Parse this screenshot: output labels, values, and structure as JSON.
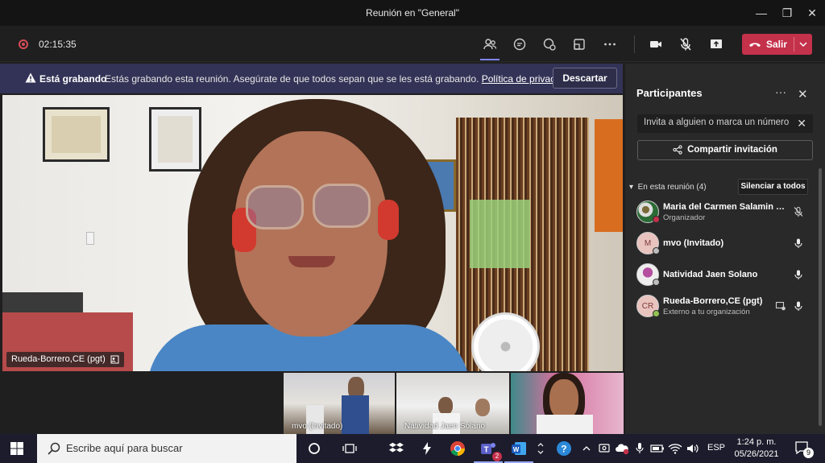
{
  "window": {
    "title": "Reunión en \"General\""
  },
  "toolbar": {
    "timer": "02:15:35",
    "leave_label": "Salir"
  },
  "banner": {
    "bold": "Está grabando",
    "message": "Estás grabando esta reunión. Asegúrate de que todos sepan que se les está grabando.",
    "privacy_link": "Política de privacidad",
    "dismiss": "Descartar"
  },
  "main_video": {
    "name": "Rueda-Borrero,CE (pgt)"
  },
  "thumbnails": [
    {
      "name": "mvo (Invitado)"
    },
    {
      "name": "Natividad Jaen Solano"
    },
    {
      "name": ""
    }
  ],
  "panel": {
    "title": "Participantes",
    "invite_placeholder": "Invita a alguien o marca un número",
    "share_label": "Compartir invitación",
    "in_meeting": "En esta reunión (4)",
    "mute_all": "Silenciar a todos",
    "participants": [
      {
        "name": "Maria del Carmen Salamin Ca...",
        "role": "Organizador",
        "initials": "",
        "status_color": "#c4314b",
        "mic": "mic-off-icon"
      },
      {
        "name": "mvo (Invitado)",
        "role": "",
        "initials": "M",
        "status_color": "#bdbdbd",
        "mic": "mic-icon"
      },
      {
        "name": "Natividad Jaen Solano",
        "role": "",
        "initials": "",
        "status_color": "#bdbdbd",
        "mic": "mic-icon"
      },
      {
        "name": "Rueda-Borrero,CE (pgt)",
        "role": "Externo a tu organización",
        "initials": "CR",
        "status_color": "#92c353",
        "mic": "mic-icon"
      }
    ]
  },
  "taskbar": {
    "search_placeholder": "Escribe aquí para buscar",
    "teams_badge": "2",
    "lang": "ESP",
    "time": "1:24 p. m.",
    "date": "05/26/2021",
    "notifications": "9"
  },
  "colors": {
    "accent": "#7f85f5",
    "leave": "#c4314b",
    "banner": "#333357"
  }
}
